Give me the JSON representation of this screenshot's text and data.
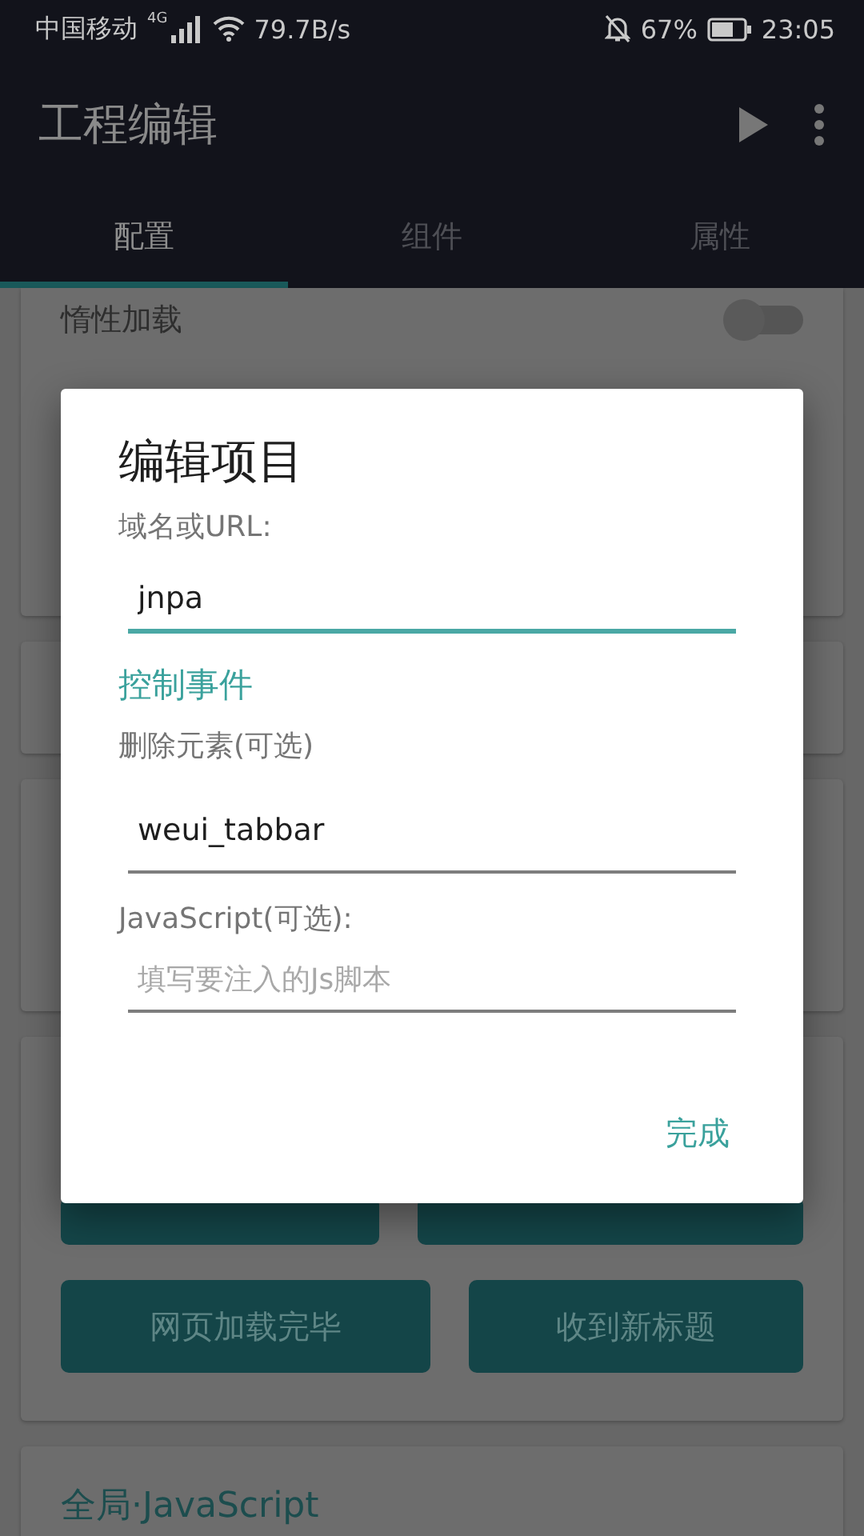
{
  "status_bar": {
    "carrier": "中国移动",
    "network": "4G",
    "speed": "79.7B/s",
    "battery": "67%",
    "time": "23:05"
  },
  "app_bar": {
    "title": "工程编辑"
  },
  "tabs": [
    {
      "label": "配置",
      "selected": true
    },
    {
      "label": "组件",
      "selected": false
    },
    {
      "label": "属性",
      "selected": false
    }
  ],
  "settings": {
    "lazy_load": {
      "label": "惰性加载",
      "on": false
    }
  },
  "event_buttons": [
    {
      "kind": "covered"
    },
    {
      "kind": "covered"
    },
    {
      "kind": "labeled",
      "label": "网页加载完毕"
    },
    {
      "kind": "labeled",
      "label": "收到新标题"
    }
  ],
  "global_js": {
    "title": "全局·JavaScript"
  },
  "dialog": {
    "title": "编辑项目",
    "url_label": "域名或URL:",
    "url_value": "jnpa",
    "section": "控制事件",
    "remove_label": "删除元素(可选)",
    "remove_value": "weui_tabbar",
    "js_label": "JavaScript(可选):",
    "js_placeholder": "填写要注入的Js脚本",
    "done": "完成"
  }
}
